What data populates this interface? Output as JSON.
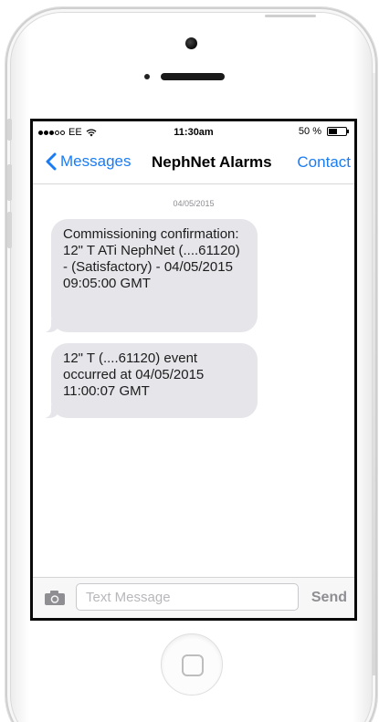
{
  "status_bar": {
    "carrier": "EE",
    "signal_strength": 3,
    "signal_total": 5,
    "time": "11:30am",
    "battery_percent_label": "50 %",
    "battery_level": 0.5
  },
  "nav": {
    "back_label": "Messages",
    "title": "NephNet Alarms",
    "contact_label": "Contact"
  },
  "thread": {
    "date": "04/05/2015",
    "messages": [
      {
        "text": "Commissioning confirmation: 12\" T ATi NephNet (....61120) - (Satisfactory) - 04/05/2015 09:05:00 GMT"
      },
      {
        "text": "12\" T (....61120) event occurred at 04/05/2015 11:00:07 GMT"
      }
    ]
  },
  "composer": {
    "placeholder": "Text Message",
    "value": "",
    "send_label": "Send"
  },
  "colors": {
    "accent": "#1a7cf5",
    "bubble_incoming": "#e5e5ea",
    "send_disabled": "#8e8e93"
  },
  "icons": {
    "back": "chevron-left-icon",
    "wifi": "wifi-icon",
    "battery": "battery-icon",
    "camera": "camera-icon",
    "home": "home-button"
  }
}
